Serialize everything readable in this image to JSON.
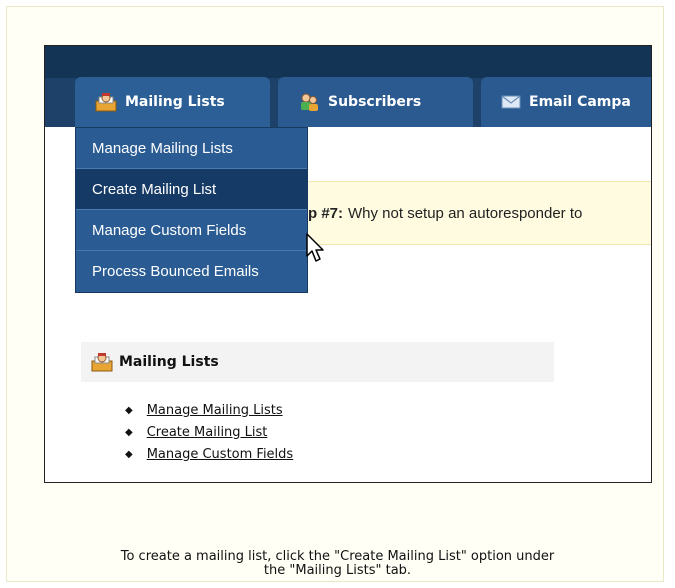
{
  "tabs": [
    {
      "label": "Mailing Lists",
      "icon": "mailing-list-icon"
    },
    {
      "label": "Subscribers",
      "icon": "subscribers-icon"
    },
    {
      "label": "Email Campa",
      "icon": "envelope-icon"
    }
  ],
  "dropdown": {
    "items": [
      {
        "label": "Manage Mailing Lists"
      },
      {
        "label": "Create Mailing List",
        "active": true
      },
      {
        "label": "Manage Custom Fields"
      },
      {
        "label": "Process Bounced Emails"
      }
    ]
  },
  "tip": {
    "prefix": "p #7:",
    "text": "Why not setup an autoresponder to"
  },
  "section": {
    "title": "Mailing Lists",
    "icon": "mailing-list-icon",
    "links": [
      "Manage Mailing Lists",
      "Create Mailing List",
      "Manage Custom Fields"
    ]
  },
  "caption": {
    "line1": "To create a mailing list, click the \"Create Mailing List\" option under",
    "line2": "the \"Mailing Lists\" tab."
  },
  "colors": {
    "topbar": "#1d4169",
    "tab": "#2a5a8f",
    "dropdown": "#2a5c93",
    "dropdown_active": "#163a66",
    "tip_bg": "#fffbe0"
  }
}
